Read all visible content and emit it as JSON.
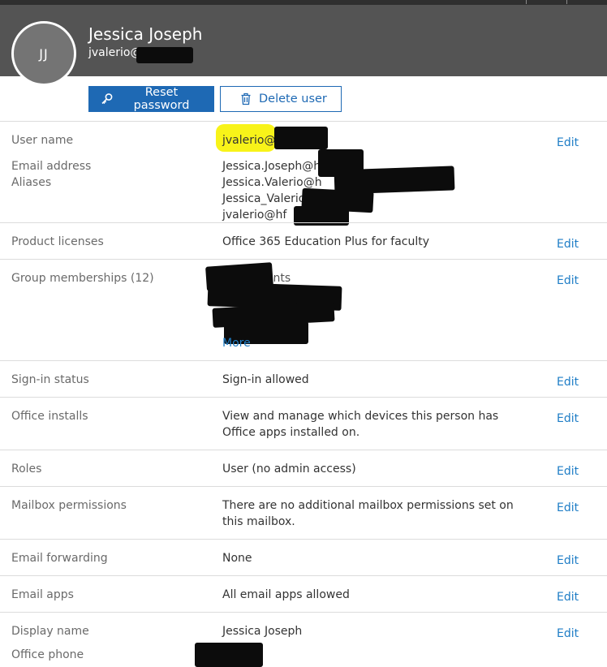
{
  "header": {
    "initials": "JJ",
    "name": "Jessica Joseph",
    "email_visible": "jvalerio@h"
  },
  "actions": {
    "reset_password": "Reset password",
    "delete_user": "Delete user"
  },
  "rows": {
    "username": {
      "label": "User name",
      "value": "jvalerio@h",
      "edit": "Edit"
    },
    "email": {
      "label": "Email address",
      "aliases_label": "Aliases",
      "values": [
        "Jessica.Joseph@h",
        "Jessica.Valerio@h",
        "Jessica_Valerio@",
        "jvalerio@hf"
      ],
      "edit": ""
    },
    "licenses": {
      "label": "Product licenses",
      "value": "Office 365 Education Plus for faculty",
      "edit": "Edit"
    },
    "groups": {
      "label": "Group memberships (12)",
      "value": "All Students",
      "more": "More",
      "edit": "Edit"
    },
    "signin": {
      "label": "Sign-in status",
      "value": "Sign-in allowed",
      "edit": "Edit"
    },
    "installs": {
      "label": "Office installs",
      "value_line1": "View and manage which devices this person has",
      "value_line2": "Office apps installed on.",
      "edit": "Edit"
    },
    "roles": {
      "label": "Roles",
      "value": "User (no admin access)",
      "edit": "Edit"
    },
    "mailbox": {
      "label": "Mailbox permissions",
      "value_line1": "There are no additional mailbox permissions set on",
      "value_line2": "this mailbox.",
      "edit": "Edit"
    },
    "forwarding": {
      "label": "Email forwarding",
      "value": "None",
      "edit": "Edit"
    },
    "emailapps": {
      "label": "Email apps",
      "value": "All email apps allowed",
      "edit": "Edit"
    },
    "display": {
      "label": "Display name",
      "value": "Jessica Joseph",
      "edit": "Edit",
      "phone_label": "Office phone"
    }
  },
  "colors": {
    "accent": "#1e69b4",
    "link": "#1e7dc6",
    "header_bg": "#545454"
  }
}
